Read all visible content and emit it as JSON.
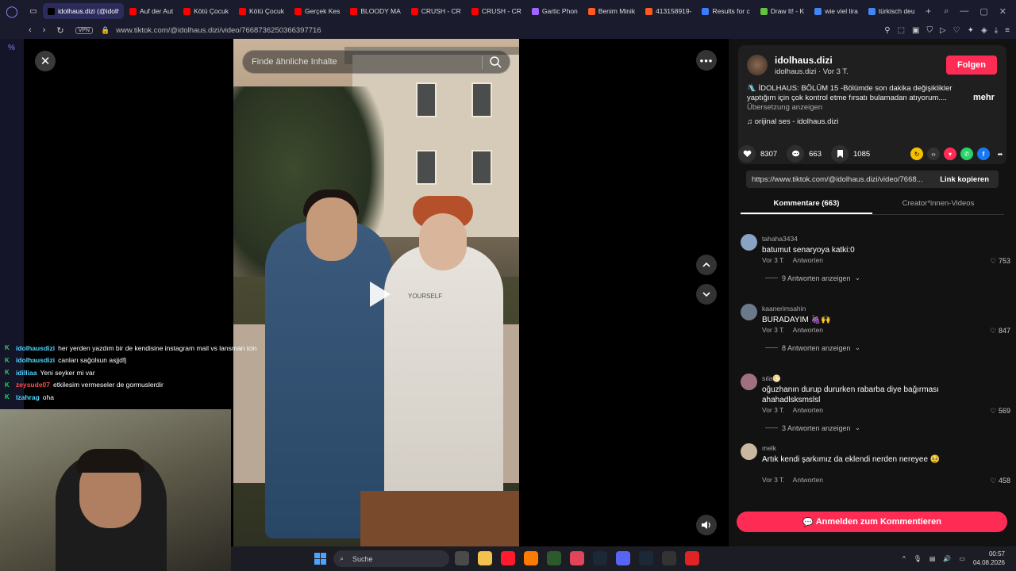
{
  "browser": {
    "tabs": [
      {
        "label": "idolhaus.dizi (@idolha",
        "active": true,
        "color": "#000000"
      },
      {
        "label": "Auf der Aut",
        "color": "#ff0000"
      },
      {
        "label": "Kötü Çocuk",
        "color": "#ff0000"
      },
      {
        "label": "Kötü Çocuk",
        "color": "#ff0000"
      },
      {
        "label": "Gerçek Kes",
        "color": "#ff0000"
      },
      {
        "label": "BLOODY MA",
        "color": "#ff0000"
      },
      {
        "label": "CRUSH - CR",
        "color": "#ff0000"
      },
      {
        "label": "CRUSH - CR",
        "color": "#ff0000"
      },
      {
        "label": "Gartic Phon",
        "color": "#a064ff"
      },
      {
        "label": "Benim Minik",
        "color": "#ff5a1f"
      },
      {
        "label": "413158919-",
        "color": "#ff5a1f"
      },
      {
        "label": "Results for c",
        "color": "#3a7bff"
      },
      {
        "label": "Draw It! - K",
        "color": "#63c23f"
      },
      {
        "label": "wie viel lira",
        "color": "#4285f4"
      },
      {
        "label": "türkisch deu",
        "color": "#4285f4"
      }
    ],
    "vpn_label": "VPN",
    "url": "www.tiktok.com/@idolhaus.dizi/video/7668736250366397716"
  },
  "sidebar_strip": {
    "label": "%"
  },
  "video": {
    "search_placeholder": "Finde ähnliche Inhalte",
    "hoodie_print": "YOURSELF"
  },
  "chat": [
    {
      "user": "idolhausdizi",
      "user_color": "#53d6ff",
      "message": "her yerden yazdım bir de kendisine instagram mail vs lansman icin"
    },
    {
      "user": "idolhausdizi",
      "user_color": "#53d6ff",
      "message": "canları sağolsun asjjdfj"
    },
    {
      "user": "idilliaa",
      "user_color": "#53d6ff",
      "message": "Yeni seyker mi var"
    },
    {
      "user": "zeysude07",
      "user_color": "#ff4d4d",
      "message": "etkilesim vermeseler de gormuslerdir"
    },
    {
      "user": "lzahrag",
      "user_color": "#53d6ff",
      "message": "oha"
    }
  ],
  "author": {
    "name": "idolhaus.dizi",
    "handle": "idolhaus.dizi",
    "time": "Vor 3 T.",
    "follow_label": "Folgen",
    "description": "🛝 İDOLHAUS: BÖLÜM 15 -Bölümde son dakika değişiklikler yaptığım için çok kontrol etme fırsatı bulamadan atıyorum....",
    "translate_label": "Übersetzung anzeigen",
    "more_label": "mehr",
    "music": "orijinal ses - idolhaus.dizi"
  },
  "stats": {
    "likes": "8307",
    "comments": "663",
    "saves": "1085"
  },
  "link": {
    "url": "https://www.tiktok.com/@idolhaus.dizi/video/7668...",
    "copy_label": "Link kopieren"
  },
  "panel_tabs": {
    "comments": "Kommentare (663)",
    "creator": "Creator*innen-Videos"
  },
  "comments": [
    {
      "user": "tahaha3434",
      "text": "batumut senaryoya katki:0",
      "time": "Vor 3 T.",
      "reply": "Antworten",
      "likes": "753",
      "replies": "9 Antworten anzeigen",
      "avatar_color": "#8aa3c2"
    },
    {
      "user": "kaanerimsahin",
      "text": "BURADAYIM 🍇🙌",
      "time": "Vor 3 T.",
      "reply": "Antworten",
      "likes": "847",
      "replies": "8 Antworten anzeigen",
      "avatar_color": "#6b7a8a"
    },
    {
      "user": "sıla🌕",
      "text": "oğuzhanın durup dururken rabarba diye bağırması ahahadlsksmslsl",
      "time": "Vor 3 T.",
      "reply": "Antworten",
      "likes": "569",
      "replies": "3 Antworten anzeigen",
      "avatar_color": "#a07080"
    },
    {
      "user": "melk",
      "text": "Artık kendi şarkımız da eklendi nerden nereyee 🥹",
      "time": "Vor 3 T.",
      "reply": "Antworten",
      "likes": "458",
      "replies": "",
      "avatar_color": "#c9b7a0"
    }
  ],
  "login_label": "Anmelden zum Kommentieren",
  "taskbar": {
    "search_label": "Suche",
    "time": "00:57",
    "date": "04.08.2026",
    "apps": [
      "#4a4a4a",
      "#f2c14e",
      "#ff1b2d",
      "#ff7a00",
      "#2d5a2d",
      "#e0455c",
      "#1b2838",
      "#5865f2",
      "#1b2838",
      "#333333",
      "#e02424"
    ]
  }
}
